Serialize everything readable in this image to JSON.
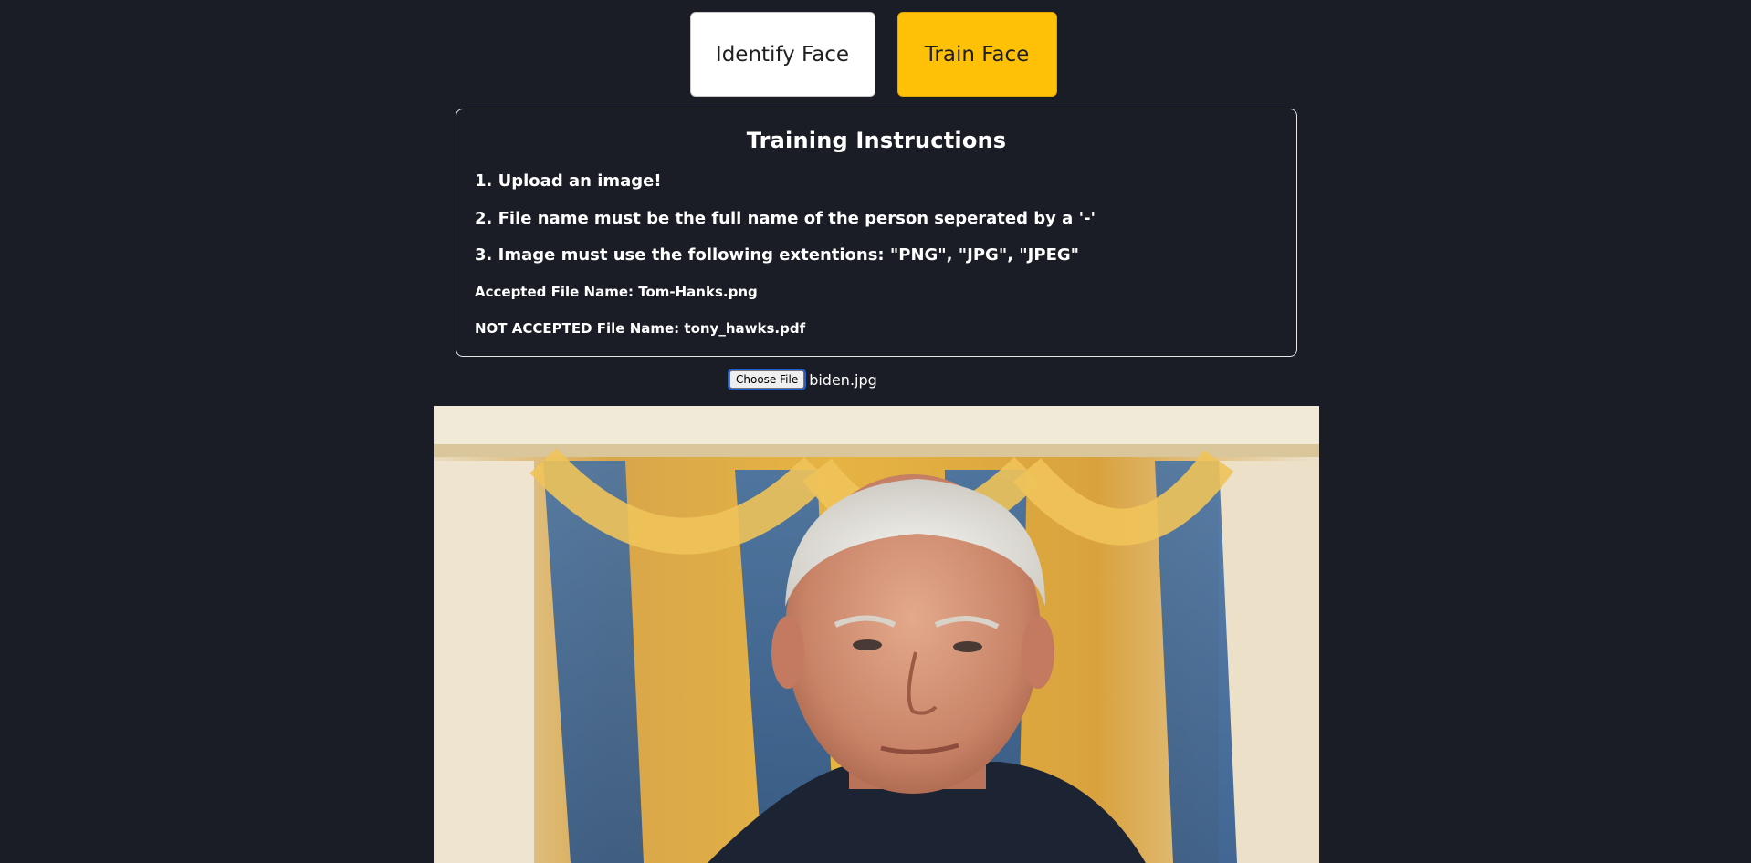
{
  "nav": {
    "identify_label": "Identify Face",
    "train_label": "Train Face",
    "active_mode_color": "#ffc107"
  },
  "instructions": {
    "title": "Training Instructions",
    "steps": [
      "1. Upload an image!",
      "2. File name must be the full name of the person seperated by a '-'",
      "3. Image must use the following extentions: \"PNG\", \"JPG\", \"JPEG\""
    ],
    "accepted_example": "Accepted File Name: Tom-Hanks.png",
    "rejected_example": "NOT ACCEPTED File Name: tony_hawks.pdf"
  },
  "upload": {
    "button_label": "Choose File",
    "selected_file": "biden.jpg"
  },
  "preview": {
    "icon": "uploaded-photo"
  }
}
